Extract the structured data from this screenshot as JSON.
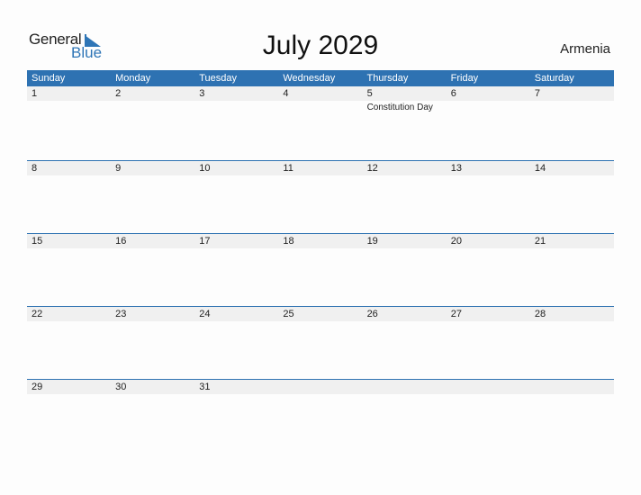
{
  "logo": {
    "word1": "General",
    "word2": "Blue",
    "icon": "triangle-flag-icon"
  },
  "title": "July 2029",
  "country": "Armenia",
  "colors": {
    "accent": "#2e72b2",
    "row_band": "#f0f0f0"
  },
  "weekdays": [
    "Sunday",
    "Monday",
    "Tuesday",
    "Wednesday",
    "Thursday",
    "Friday",
    "Saturday"
  ],
  "weeks": [
    [
      {
        "d": "1"
      },
      {
        "d": "2"
      },
      {
        "d": "3"
      },
      {
        "d": "4"
      },
      {
        "d": "5",
        "event": "Constitution Day"
      },
      {
        "d": "6"
      },
      {
        "d": "7"
      }
    ],
    [
      {
        "d": "8"
      },
      {
        "d": "9"
      },
      {
        "d": "10"
      },
      {
        "d": "11"
      },
      {
        "d": "12"
      },
      {
        "d": "13"
      },
      {
        "d": "14"
      }
    ],
    [
      {
        "d": "15"
      },
      {
        "d": "16"
      },
      {
        "d": "17"
      },
      {
        "d": "18"
      },
      {
        "d": "19"
      },
      {
        "d": "20"
      },
      {
        "d": "21"
      }
    ],
    [
      {
        "d": "22"
      },
      {
        "d": "23"
      },
      {
        "d": "24"
      },
      {
        "d": "25"
      },
      {
        "d": "26"
      },
      {
        "d": "27"
      },
      {
        "d": "28"
      }
    ],
    [
      {
        "d": "29"
      },
      {
        "d": "30"
      },
      {
        "d": "31"
      },
      {
        "d": ""
      },
      {
        "d": ""
      },
      {
        "d": ""
      },
      {
        "d": ""
      }
    ]
  ]
}
